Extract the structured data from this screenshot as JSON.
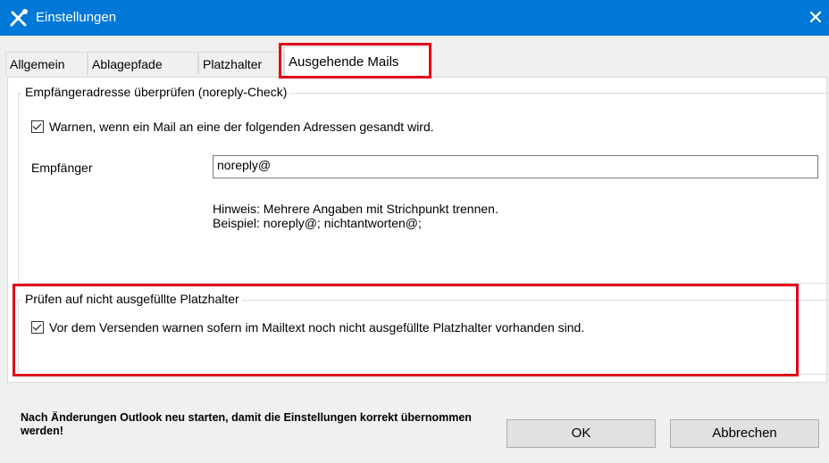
{
  "window": {
    "title": "Einstellungen",
    "close_glyph": "✕"
  },
  "tabs": [
    {
      "label": "Allgemein"
    },
    {
      "label": "Ablagepfade"
    },
    {
      "label": "Platzhalter"
    },
    {
      "label": "Ausgehende Mails"
    }
  ],
  "noreply_group": {
    "legend": "Empfängeradresse überprüfen (noreply-Check)",
    "warn_checkbox": {
      "label": "Warnen, wenn ein Mail an eine der folgenden Adressen gesandt wird.",
      "checked": true
    },
    "recipient_label": "Empfänger",
    "recipient_value": "noreply@",
    "hint_line1": "Hinweis:  Mehrere Angaben mit Strichpunkt trennen.",
    "hint_line2": "Beispiel: noreply@; nichtantworten@;"
  },
  "placeholder_group": {
    "legend": "Prüfen auf nicht ausgefüllte Platzhalter",
    "warn_checkbox": {
      "label": "Vor dem Versenden warnen sofern im Mailtext noch nicht ausgefüllte Platzhalter vorhanden sind.",
      "checked": true
    }
  },
  "footer": {
    "note": "Nach Änderungen Outlook neu starten, damit die Einstellungen korrekt übernommen werden!",
    "ok_label": "OK",
    "cancel_label": "Abbrechen"
  },
  "colors": {
    "titlebar": "#0078d7",
    "highlight": "#e3001b"
  },
  "icons": {
    "app": "tools-icon",
    "close": "close-icon"
  }
}
